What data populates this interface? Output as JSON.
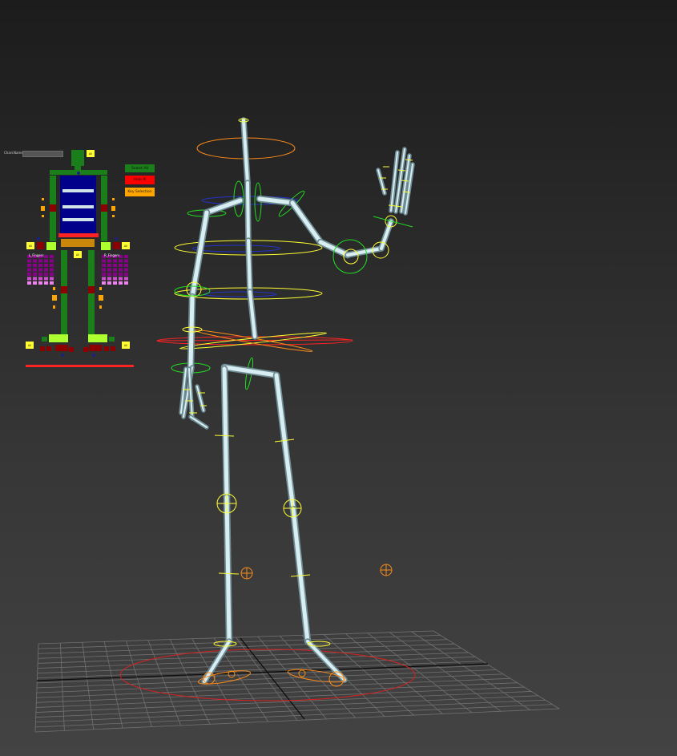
{
  "viewport": {
    "background": "#2e2e2e"
  },
  "picker": {
    "chars_label": "Chars",
    "name_label": "Name",
    "buttons": {
      "select_all": "Select All",
      "hide_ik": "Hide IK",
      "key_selection": "Key Selection"
    },
    "all_label": "All",
    "finger_labels": {
      "left": "L_Fingers",
      "right": "R_Fingers"
    },
    "colors": {
      "spine": "#00008b",
      "limb": "#1a7f1a",
      "joint": "#8b0000",
      "control": "#ffa500",
      "highlight": "#adff2f",
      "root": "#ff0000",
      "finger": "#8b008b"
    }
  },
  "rig": {
    "colors": {
      "bone": "#cde6ec",
      "yellow": "#ffff33",
      "green": "#22dd22",
      "orange": "#ff8c1a",
      "red": "#ff2222",
      "blue": "#2233cc",
      "grid": "#7d7d7d"
    }
  }
}
